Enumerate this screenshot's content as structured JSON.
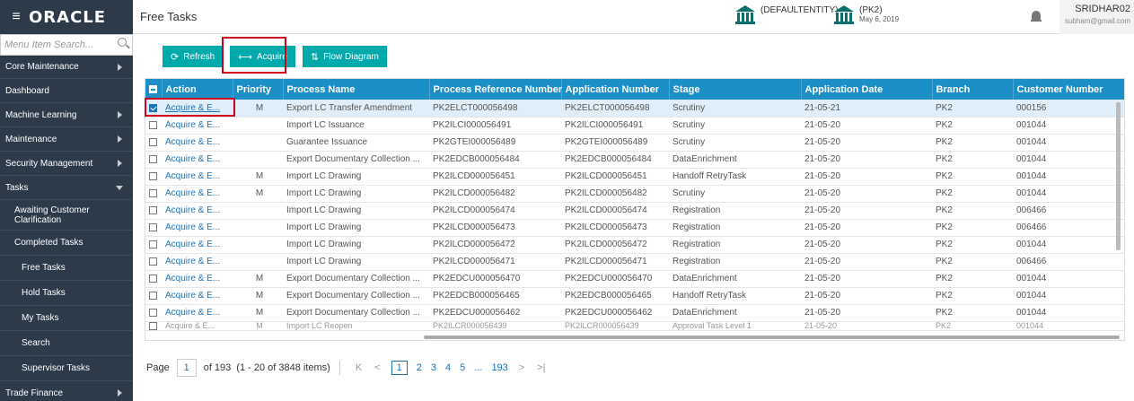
{
  "app": {
    "logo": "ORACLE",
    "page_title": "Free Tasks"
  },
  "header": {
    "entity1": {
      "label": "(DEFAULTENTITY)"
    },
    "entity2": {
      "label": "(PK2)",
      "date": "May 6, 2019"
    },
    "user": {
      "name": "SRIDHAR02",
      "email": "subham@gmail.com"
    }
  },
  "sidebar": {
    "search_placeholder": "Menu Item Search...",
    "items": [
      {
        "label": "Core Maintenance"
      },
      {
        "label": "Dashboard"
      },
      {
        "label": "Machine Learning"
      },
      {
        "label": "Maintenance"
      },
      {
        "label": "Security Management"
      },
      {
        "label": "Tasks"
      },
      {
        "label": "Awaiting Customer Clarification"
      },
      {
        "label": "Completed Tasks"
      },
      {
        "label": "Free Tasks"
      },
      {
        "label": "Hold Tasks"
      },
      {
        "label": "My Tasks"
      },
      {
        "label": "Search"
      },
      {
        "label": "Supervisor Tasks"
      },
      {
        "label": "Trade Finance"
      }
    ]
  },
  "toolbar": {
    "refresh": "Refresh",
    "acquire": "Acquire",
    "flow": "Flow Diagram"
  },
  "table": {
    "headers": [
      "Action",
      "Priority",
      "Process Name",
      "Process Reference Number",
      "Application Number",
      "Stage",
      "Application Date",
      "Branch",
      "Customer Number"
    ],
    "rows": [
      [
        "Acquire & E...",
        "M",
        "Export LC Transfer Amendment",
        "PK2ELCT000056498",
        "PK2ELCT000056498",
        "Scrutiny",
        "21-05-21",
        "PK2",
        "000156"
      ],
      [
        "Acquire & E...",
        "",
        "Import LC Issuance",
        "PK2ILCI000056491",
        "PK2ILCI000056491",
        "Scrutiny",
        "21-05-20",
        "PK2",
        "001044"
      ],
      [
        "Acquire & E...",
        "",
        "Guarantee Issuance",
        "PK2GTEI000056489",
        "PK2GTEI000056489",
        "Scrutiny",
        "21-05-20",
        "PK2",
        "001044"
      ],
      [
        "Acquire & E...",
        "",
        "Export Documentary Collection ...",
        "PK2EDCB000056484",
        "PK2EDCB000056484",
        "DataEnrichment",
        "21-05-20",
        "PK2",
        "001044"
      ],
      [
        "Acquire & E...",
        "M",
        "Import LC Drawing",
        "PK2ILCD000056451",
        "PK2ILCD000056451",
        "Handoff RetryTask",
        "21-05-20",
        "PK2",
        "001044"
      ],
      [
        "Acquire & E...",
        "M",
        "Import LC Drawing",
        "PK2ILCD000056482",
        "PK2ILCD000056482",
        "Scrutiny",
        "21-05-20",
        "PK2",
        "001044"
      ],
      [
        "Acquire & E...",
        "",
        "Import LC Drawing",
        "PK2ILCD000056474",
        "PK2ILCD000056474",
        "Registration",
        "21-05-20",
        "PK2",
        "006466"
      ],
      [
        "Acquire & E...",
        "",
        "Import LC Drawing",
        "PK2ILCD000056473",
        "PK2ILCD000056473",
        "Registration",
        "21-05-20",
        "PK2",
        "006466"
      ],
      [
        "Acquire & E...",
        "",
        "Import LC Drawing",
        "PK2ILCD000056472",
        "PK2ILCD000056472",
        "Registration",
        "21-05-20",
        "PK2",
        "001044"
      ],
      [
        "Acquire & E...",
        "",
        "Import LC Drawing",
        "PK2ILCD000056471",
        "PK2ILCD000056471",
        "Registration",
        "21-05-20",
        "PK2",
        "006466"
      ],
      [
        "Acquire & E...",
        "M",
        "Export Documentary Collection ...",
        "PK2EDCU000056470",
        "PK2EDCU000056470",
        "DataEnrichment",
        "21-05-20",
        "PK2",
        "001044"
      ],
      [
        "Acquire & E...",
        "M",
        "Export Documentary Collection ...",
        "PK2EDCB000056465",
        "PK2EDCB000056465",
        "Handoff RetryTask",
        "21-05-20",
        "PK2",
        "001044"
      ],
      [
        "Acquire & E...",
        "M",
        "Export Documentary Collection ...",
        "PK2EDCU000056462",
        "PK2EDCU000056462",
        "DataEnrichment",
        "21-05-20",
        "PK2",
        "001044"
      ],
      [
        "Acquire & E...",
        "M",
        "Import LC Reopen",
        "PK2ILCR000056439",
        "PK2ILCR000056439",
        "Approval Task Level 1",
        "21-05-20",
        "PK2",
        "001044"
      ]
    ]
  },
  "pager": {
    "label": "Page",
    "current": "1",
    "of_text": "of 193",
    "range_text": "(1 - 20 of 3848 items)",
    "first": "K",
    "prev": "<",
    "pages": [
      "1",
      "2",
      "3",
      "4",
      "5",
      "...",
      "193"
    ],
    "next": ">",
    "last": ">|"
  },
  "colors": {
    "accent": "#00aaaa",
    "header_bg": "#1c8fc6",
    "sidebar_bg": "#2d3a4a",
    "highlight": "#d0021b"
  }
}
